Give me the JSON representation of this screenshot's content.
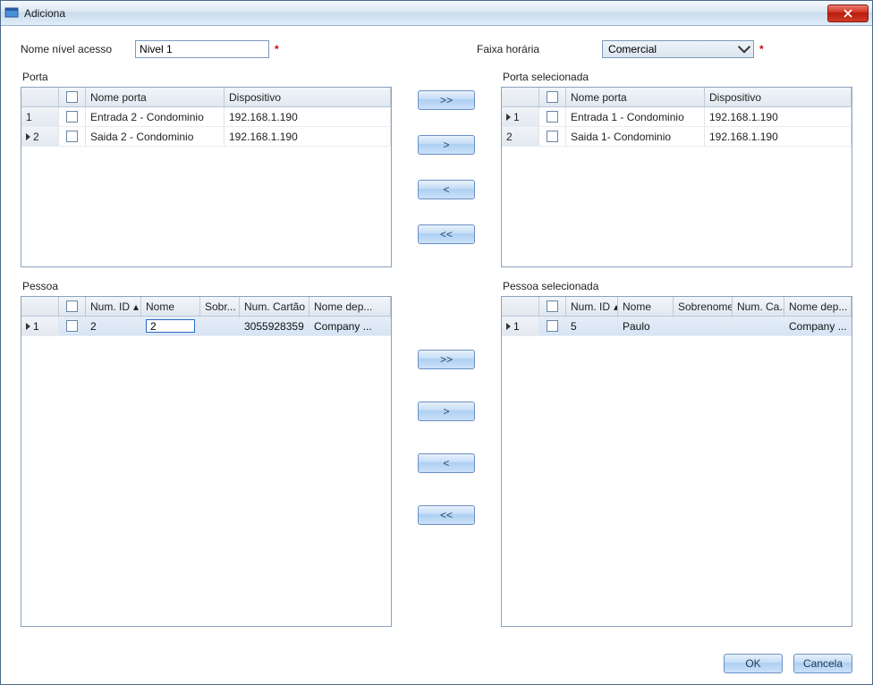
{
  "window": {
    "title": "Adiciona"
  },
  "labels": {
    "nome_nivel": "Nome nível acesso",
    "faixa_horaria": "Faixa horária",
    "porta": "Porta",
    "porta_sel": "Porta selecionada",
    "pessoa": "Pessoa",
    "pessoa_sel": "Pessoa selecionada"
  },
  "fields": {
    "nivel_value": "Nivel 1",
    "faixa_value": "Comercial"
  },
  "porta_headers": {
    "nome": "Nome porta",
    "disp": "Dispositivo"
  },
  "porta_rows": [
    {
      "idx": "1",
      "nome": "Entrada 2 - Condominio",
      "disp": "192.168.1.190",
      "current": false
    },
    {
      "idx": "2",
      "nome": "Saida 2 - Condominio",
      "disp": "192.168.1.190",
      "current": true
    }
  ],
  "porta_sel_rows": [
    {
      "idx": "1",
      "nome": "Entrada 1 - Condominio",
      "disp": "192.168.1.190",
      "current": true
    },
    {
      "idx": "2",
      "nome": "Saida 1- Condominio",
      "disp": "192.168.1.190",
      "current": false
    }
  ],
  "pessoa_headers": {
    "numid": "Num. ID",
    "nome": "Nome",
    "sobr": "Sobr...",
    "numcartao": "Num. Cartão",
    "nomedep": "Nome dep..."
  },
  "pessoa_sel_headers": {
    "numid": "Num. ID",
    "nome": "Nome",
    "sobrenome": "Sobrenome",
    "numca": "Num. Ca...",
    "nomedep": "Nome dep..."
  },
  "pessoa_rows": [
    {
      "idx": "1",
      "numid": "2",
      "nome_edit": "2",
      "sobr": "",
      "numcartao": "3055928359",
      "nomedep": "Company ...",
      "current": true,
      "selected": true
    }
  ],
  "pessoa_sel_rows": [
    {
      "idx": "1",
      "numid": "5",
      "nome": "Paulo",
      "sobrenome": "",
      "numca": "",
      "nomedep": "Company ...",
      "current": true,
      "selected": true
    }
  ],
  "buttons": {
    "all_right": ">>",
    "one_right": ">",
    "one_left": "<",
    "all_left": "<<",
    "ok": "OK",
    "cancel": "Cancela"
  },
  "req_mark": "*",
  "sort_mark": "▴"
}
